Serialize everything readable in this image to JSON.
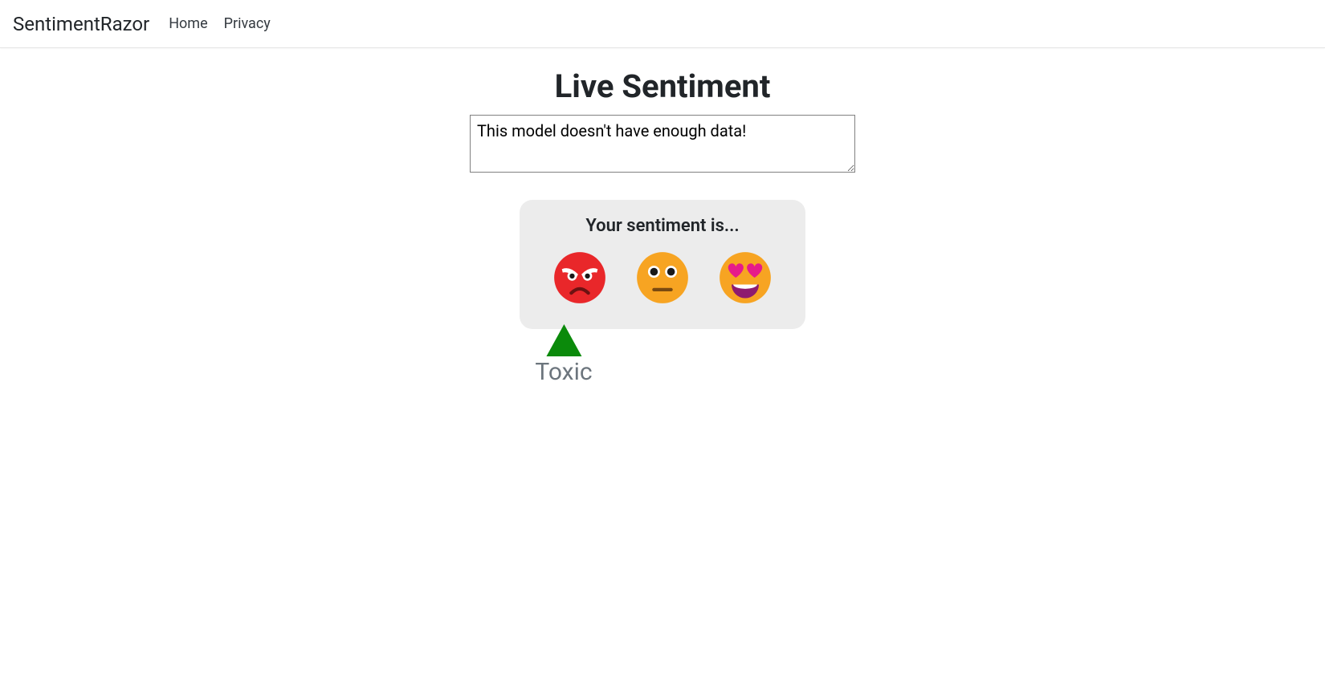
{
  "nav": {
    "brand": "SentimentRazor",
    "links": [
      {
        "label": "Home"
      },
      {
        "label": "Privacy"
      }
    ]
  },
  "main": {
    "title": "Live Sentiment",
    "input_value": "This model doesn't have enough data!",
    "card_title": "Your sentiment is...",
    "sentiments": [
      {
        "name": "toxic",
        "icon": "angry-face-icon"
      },
      {
        "name": "neutral",
        "icon": "neutral-face-icon"
      },
      {
        "name": "positive",
        "icon": "heart-eyes-face-icon"
      }
    ],
    "result_label": "Toxic",
    "result_index": 0
  },
  "colors": {
    "marker_green": "#0b8a0b",
    "card_bg": "#ececec",
    "muted_text": "#6c757d"
  }
}
